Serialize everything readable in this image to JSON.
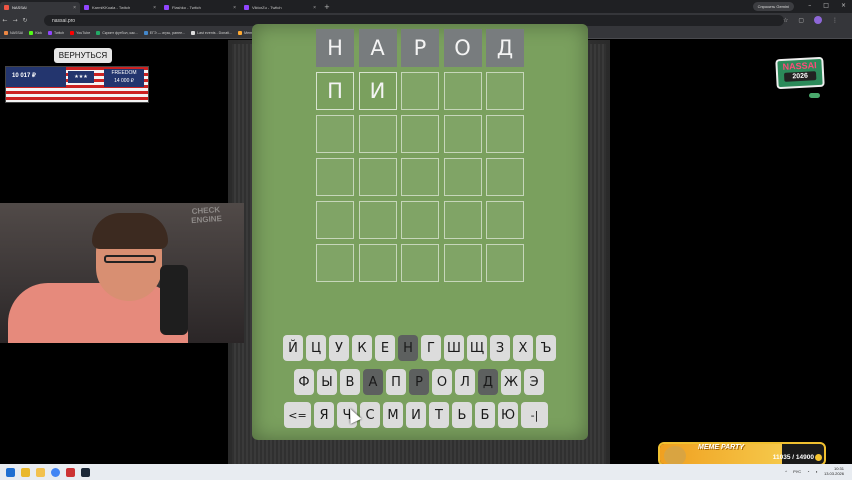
{
  "browser": {
    "tabs": [
      {
        "label": "NASSAI",
        "active": true
      },
      {
        "label": "KarmiKKoala - Twitch",
        "active": false
      },
      {
        "label": "Flashko - Twitch",
        "active": false
      },
      {
        "label": "ViktorZu - Twitch",
        "active": false
      }
    ],
    "gemini_label": "Спросить Gemini",
    "url": "nassai.pro",
    "bookmarks": [
      "NASSAI",
      "Kick",
      "Twitch",
      "YouTube",
      "Скрипт футбол, как...",
      "ЕГЭ — игры, ранее...",
      "Last events - Donati...",
      "Meme Alerts",
      "Донаты - Последн...",
      "Играть в слова онл..."
    ]
  },
  "overlay": {
    "back_label": "ВЕРНУТЬСЯ",
    "balance": "10 017 ₽",
    "freedom_label": "FREEDOM",
    "freedom_value": "14 000 ₽",
    "logo_line1": "NASSAI",
    "logo_line2": "2026",
    "meme_party": {
      "title": "MEME PARTY",
      "count": "11035 / 14900",
      "progress": 0.741
    },
    "webcam_sign": "CHECK ENGINE"
  },
  "game": {
    "rows": [
      [
        "Н",
        "А",
        "Р",
        "О",
        "Д"
      ],
      [
        "П",
        "И",
        "",
        "",
        ""
      ],
      [
        "",
        "",
        "",
        "",
        ""
      ],
      [
        "",
        "",
        "",
        "",
        ""
      ],
      [
        "",
        "",
        "",
        "",
        ""
      ],
      [
        "",
        "",
        "",
        "",
        ""
      ]
    ],
    "keyboard": {
      "row1": [
        "Й",
        "Ц",
        "У",
        "К",
        "Е",
        "Н",
        "Г",
        "Ш",
        "Щ",
        "З",
        "Х",
        "Ъ"
      ],
      "row2": [
        "Ф",
        "Ы",
        "В",
        "А",
        "П",
        "Р",
        "О",
        "Л",
        "Д",
        "Ж",
        "Э"
      ],
      "row3": [
        "<=",
        "Я",
        "Ч",
        "С",
        "М",
        "И",
        "Т",
        "Ь",
        "Б",
        "Ю",
        "-|"
      ]
    },
    "absent_keys": [
      "Н",
      "А",
      "Р",
      "Д"
    ]
  },
  "taskbar": {
    "lang": "РУС",
    "time": "10:31",
    "date": "13.03.2026"
  },
  "colors": {
    "board": "#7aa05e",
    "tile_used": "#787c7e",
    "key_absent": "#5d605f",
    "key": "#dcdcdc"
  }
}
